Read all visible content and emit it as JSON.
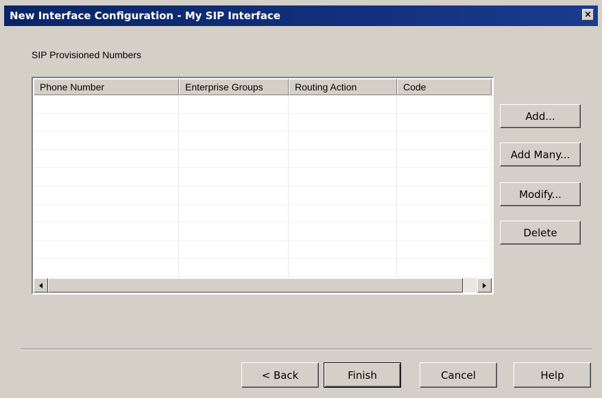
{
  "window": {
    "title": "New Interface Configuration - My SIP Interface",
    "close_glyph": "×"
  },
  "section": {
    "label": "SIP Provisioned Numbers"
  },
  "table": {
    "columns": [
      "Phone Number",
      "Enterprise Groups",
      "Routing Action",
      "Code"
    ],
    "rows": []
  },
  "side_buttons": {
    "add": "Add...",
    "add_many": "Add Many...",
    "modify": "Modify...",
    "delete": "Delete"
  },
  "footer_buttons": {
    "back": "< Back",
    "finish": "Finish",
    "cancel": "Cancel",
    "help": "Help"
  }
}
